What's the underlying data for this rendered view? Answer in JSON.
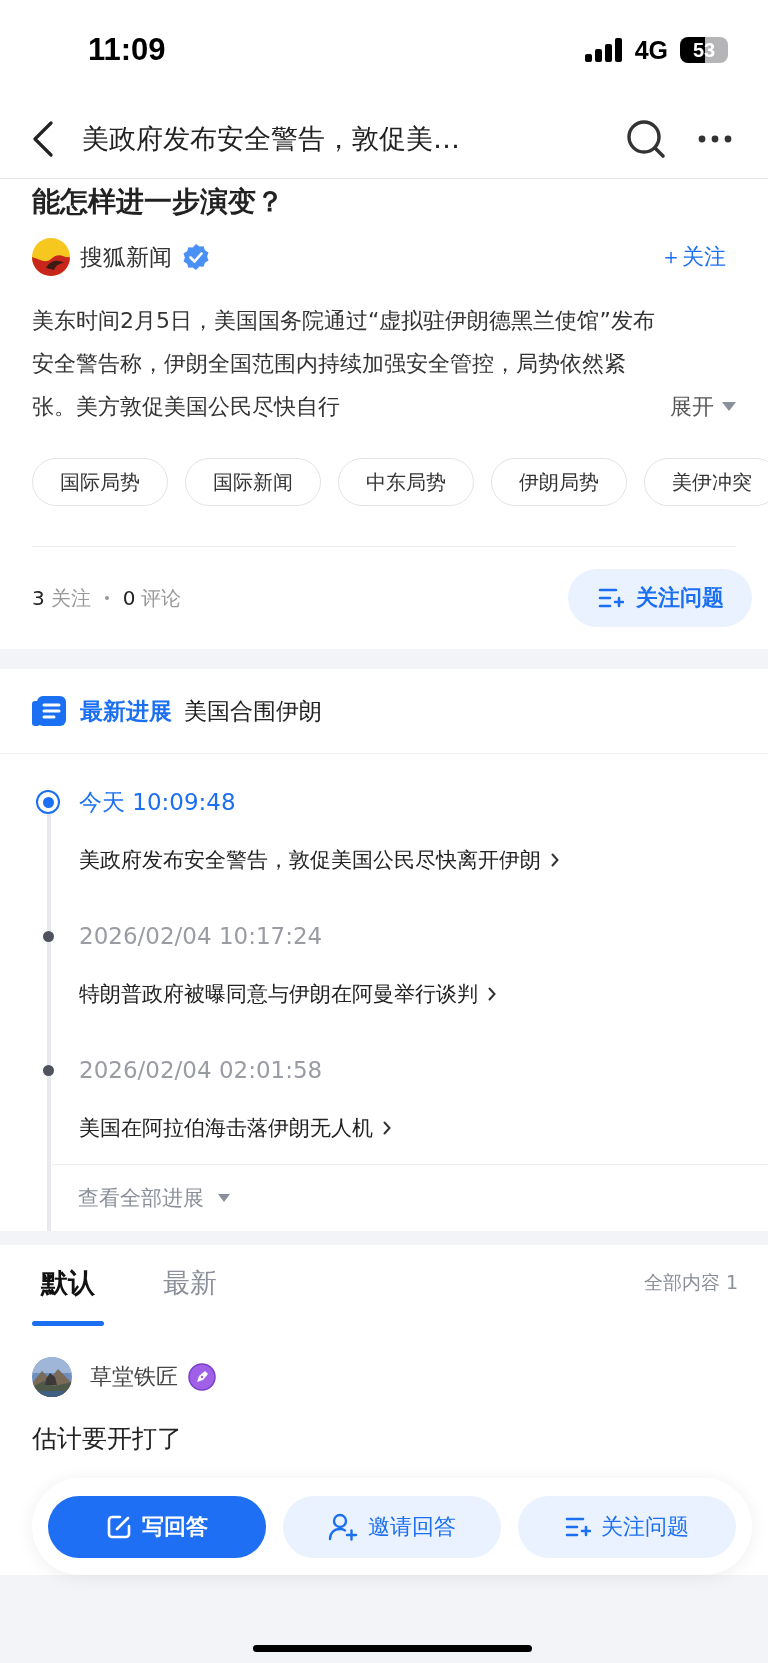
{
  "status_bar": {
    "time": "11:09",
    "network": "4G",
    "battery": "53"
  },
  "nav": {
    "title": "美政府发布安全警告，敦促美…"
  },
  "question": {
    "title_tail": "能怎样进一步演变？",
    "author": {
      "name": "搜狐新闻",
      "verified": true,
      "follow": "＋关注"
    },
    "summary": "美东时间2月5日，美国国务院通过“虚拟驻伊朗德黑兰使馆”发布安全警告称，伊朗全国范围内持续加强安全管控，局势依然紧张。美方敦促美国公民尽快自行",
    "expand": "展开",
    "tags": [
      "国际局势",
      "国际新闻",
      "中东局势",
      "伊朗局势",
      "美伊冲突"
    ],
    "stats": [
      {
        "count": "3",
        "label": "关注"
      },
      {
        "count": "0",
        "label": "评论"
      }
    ],
    "follow_button": "关注问题"
  },
  "progress": {
    "label": "最新进展",
    "topic": "美国合围伊朗",
    "events": [
      {
        "time": "今天 10:09:48",
        "title": "美政府发布安全警告，敦促美国公民尽快离开伊朗",
        "current": true
      },
      {
        "time": "2026/02/04 10:17:24",
        "title": "特朗普政府被曝同意与伊朗在阿曼举行谈判",
        "current": false
      },
      {
        "time": "2026/02/04 02:01:58",
        "title": "美国在阿拉伯海击落伊朗无人机",
        "current": false
      }
    ],
    "more": "查看全部进展"
  },
  "answers": {
    "tabs": [
      {
        "label": "默认",
        "selected": true
      },
      {
        "label": "最新",
        "selected": false
      }
    ],
    "count": "全部内容 1",
    "items": [
      {
        "author": "草堂铁匠",
        "text": "估计要开打了"
      }
    ]
  },
  "actions": [
    {
      "label": "写回答",
      "kind": "write"
    },
    {
      "label": "邀请回答",
      "kind": "invite"
    },
    {
      "label": "关注问题",
      "kind": "follow"
    }
  ]
}
